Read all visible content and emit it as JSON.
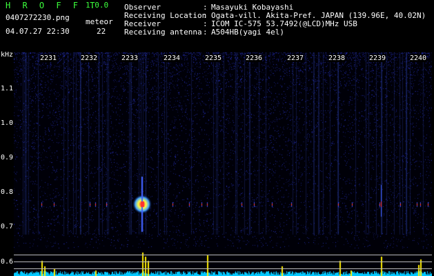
{
  "header": {
    "app_title": "H R O F F T",
    "version": "1.0.0",
    "filename": "0407272230.png",
    "datetime": "04.07.27 22:30",
    "meteor_label": "meteor",
    "meteor_count": "22"
  },
  "info": {
    "observer_label": "Observer",
    "observer_value": "Masayuki Kobayashi",
    "location_label": "Receiving Location",
    "location_value": "Ogata-vill. Akita-Pref. JAPAN (139.96E, 40.02N)",
    "receiver_label": "Receiver",
    "receiver_value": "ICOM IC-575 53.7492(@LCD)MHz USB",
    "antenna_label": "Receiving antenna",
    "antenna_value": "A504HB(yagi 4el)"
  },
  "axis": {
    "unit": "kHz",
    "y_ticks": [
      "1.1",
      "1.0",
      "0.9",
      "0.8",
      "0.7",
      "0.6"
    ],
    "x_ticks": [
      "2231",
      "2232",
      "2233",
      "2234",
      "2235",
      "2236",
      "2237",
      "2238",
      "2239",
      "2240"
    ]
  },
  "colors": {
    "title": "#3cff3c",
    "background": "#000000",
    "noise": "#1c2a8a",
    "echo": "#ff4040",
    "bar": "#ffee00",
    "baseline": "#00ffff"
  }
}
